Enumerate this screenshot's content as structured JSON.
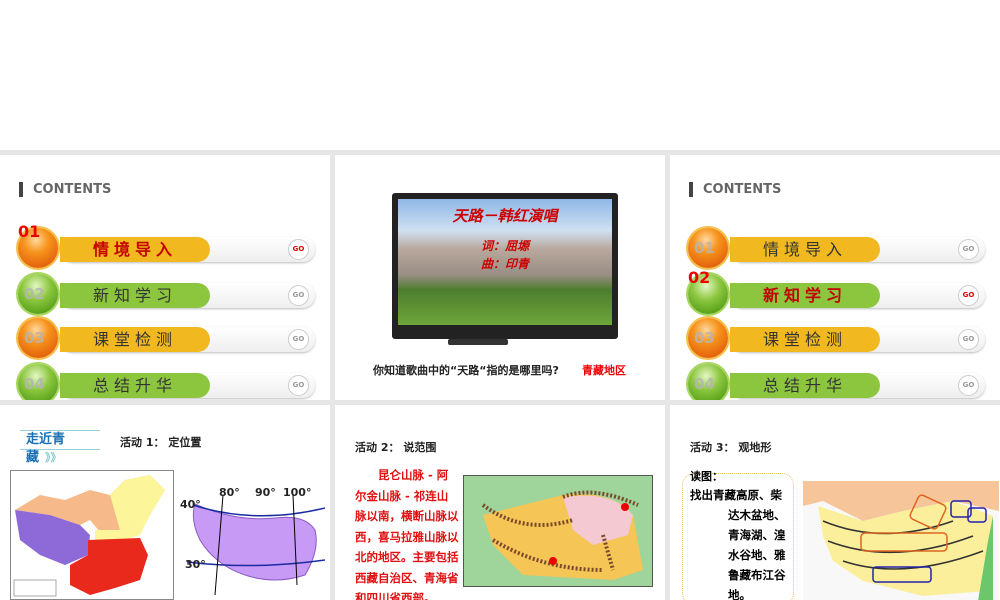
{
  "contents_heading": "CONTENTS",
  "contents_items": [
    {
      "num": "01",
      "label": "情境导入",
      "color": "o"
    },
    {
      "num": "02",
      "label": "新知学习",
      "color": "g"
    },
    {
      "num": "03",
      "label": "课堂检测",
      "color": "o"
    },
    {
      "num": "04",
      "label": "总结升华",
      "color": "g"
    }
  ],
  "go_label": "GO",
  "slide1": {
    "active_index": 0
  },
  "slide3": {
    "active_index": 1
  },
  "slide2": {
    "tv_title": "天路－韩红演唱",
    "tv_lyrics": "词：屈塬",
    "tv_music": "曲：印青",
    "question": "你知道歌曲中的“天路“指的是哪里吗?",
    "answer": "青藏地区"
  },
  "slide4": {
    "badge": "走近青藏",
    "badge_arrows": "》》",
    "activity": "活动 1： 定位置",
    "lon_labels": [
      "80°",
      "90°",
      "100°"
    ],
    "lat_labels": [
      "40°",
      "30°"
    ]
  },
  "slide5": {
    "activity": "活动 2： 说范围",
    "text": "昆仑山脉 - 阿尔金山脉 - 祁连山脉以南，横断山脉以西，喜马拉雅山脉以北的地区。主要包括西藏自治区、青海省和四川省西部。"
  },
  "slide6": {
    "activity": "活动 3： 观地形",
    "read": "读图：",
    "lines": [
      "找出青藏高原、柴",
      "达木盆地、",
      "青海湖、湟",
      "水谷地、雅",
      "鲁藏布江谷",
      "地。"
    ]
  }
}
